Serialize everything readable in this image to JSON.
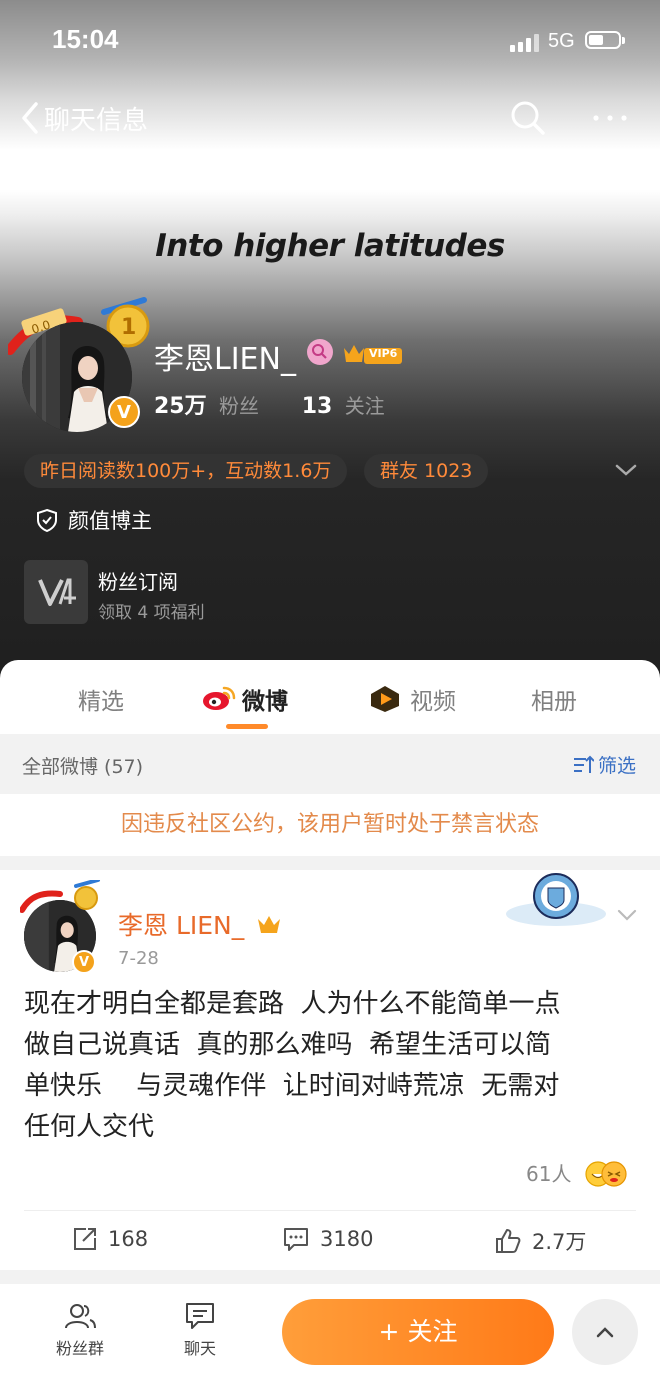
{
  "status_bar": {
    "time": "15:04",
    "network": "5G",
    "battery_level": 0.5
  },
  "nav": {
    "back_label": "聊天信息",
    "search_icon": "search-icon",
    "more_icon": "more-icon"
  },
  "profile": {
    "tagline": "Into higher latitudes",
    "name": "李恩LIEN_",
    "vip_label": "VIP6",
    "verified_badge": "V",
    "followers_count": "25万",
    "followers_label": "粉丝",
    "following_count": "13",
    "following_label": "关注",
    "stats_pill": "昨日阅读数100万+，互动数1.6万",
    "group_pill": "群友 1023",
    "tag": "颜值博主",
    "subscription": {
      "title": "粉丝订阅",
      "desc": "领取 4 项福利"
    }
  },
  "tabs": [
    {
      "label": "精选"
    },
    {
      "label": "微博"
    },
    {
      "label": "视频"
    },
    {
      "label": "相册"
    }
  ],
  "active_tab": "微博",
  "filter": {
    "all_label": "全部微博 (57)",
    "filter_label": "筛选"
  },
  "ban_notice": "因违反社区公约，该用户暂时处于禁言状态",
  "post": {
    "author": "李恩 LIEN_",
    "date": "7-28",
    "text": "现在才明白全都是套路 人为什么不能简单一点做自己说真话 真的那么难吗 希望生活可以简单快乐　与灵魂作伴 让时间对峙荒凉 无需对任何人交代",
    "text_lines": [
      "现在才明白全都是套路  人为什么不能简单一点",
      "做自己说真话  真的那么难吗  希望生活可以简",
      "单快乐　 与灵魂作伴  让时间对峙荒凉  无需对",
      "任何人交代"
    ],
    "reactions": "61人",
    "reposts": "168",
    "comments": "3180",
    "likes": "2.7万"
  },
  "bottom_bar": {
    "fans_group": "粉丝群",
    "chat": "聊天",
    "follow": "+ 关注"
  },
  "colors": {
    "accent": "#ff8a2a",
    "name_orange": "#e86a2a",
    "link_blue": "#3b70c4",
    "ban_text": "#e38a4b"
  }
}
